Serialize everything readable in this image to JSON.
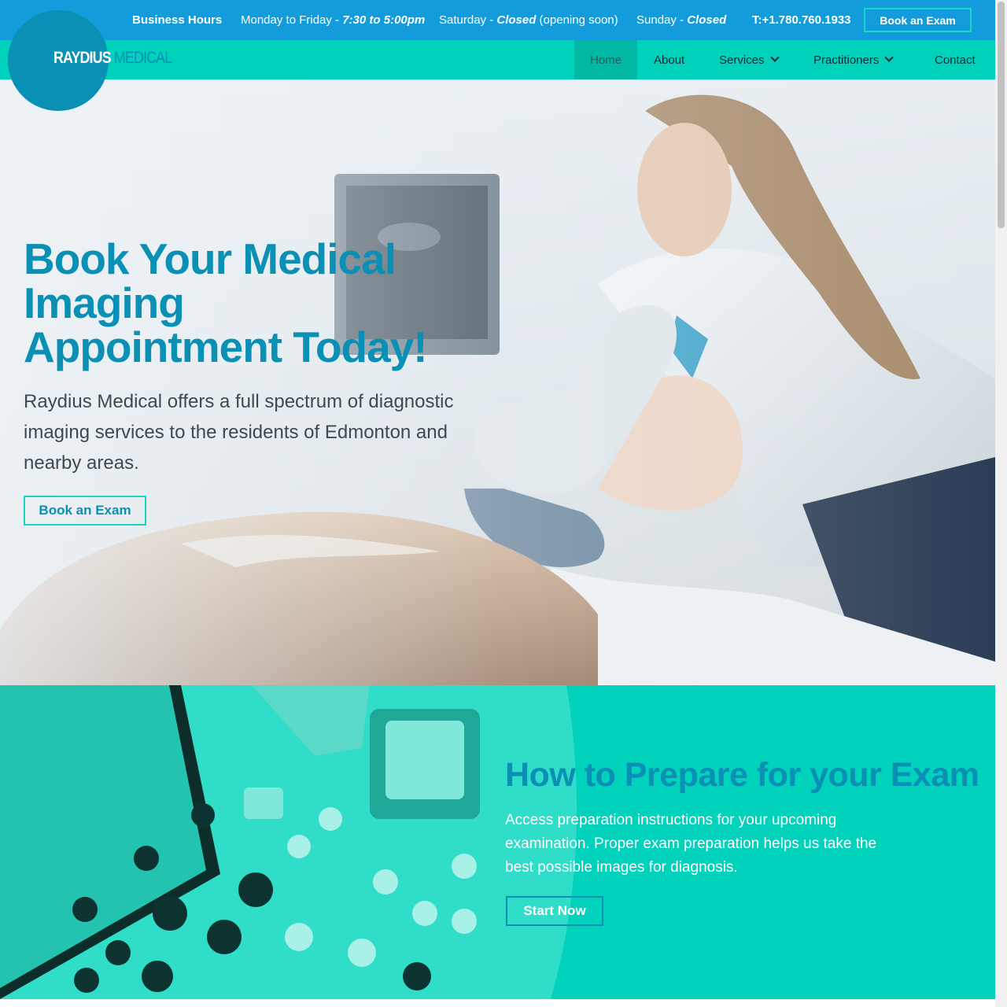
{
  "topbar": {
    "hours_label": "Business Hours",
    "weekday_prefix": "Monday to Friday - ",
    "weekday_hours": "7:30 to 5:00pm",
    "saturday_prefix": "Saturday - ",
    "saturday_status": "Closed",
    "saturday_note": " (opening soon)",
    "sunday_prefix": "Sunday - ",
    "sunday_status": "Closed",
    "phone": "T:+1.780.760.1933",
    "book_label": "Book an Exam"
  },
  "logo": {
    "part1": "RAYDIUS",
    "part2": "MEDICAL"
  },
  "nav": {
    "home": "Home",
    "about": "About",
    "services": "Services",
    "practitioners": "Practitioners",
    "contact": "Contact"
  },
  "hero": {
    "title_line1": "Book Your Medical",
    "title_line2": "Imaging",
    "title_line3": "Appointment Today!",
    "subtitle": "Raydius Medical offers a full spectrum of diagnostic imaging services to the residents of Edmonton and nearby areas.",
    "button": "Book an Exam"
  },
  "prep": {
    "title": "How to Prepare for your Exam",
    "text": "Access preparation instructions for your upcoming examination. Proper exam preparation helps us take the best possible images for diagnosis.",
    "button": "Start Now"
  },
  "colors": {
    "topbar": "#139cdb",
    "nav": "#00d1bb",
    "brand_blue": "#0a8fb5",
    "accent_teal": "#1ad6c0"
  }
}
